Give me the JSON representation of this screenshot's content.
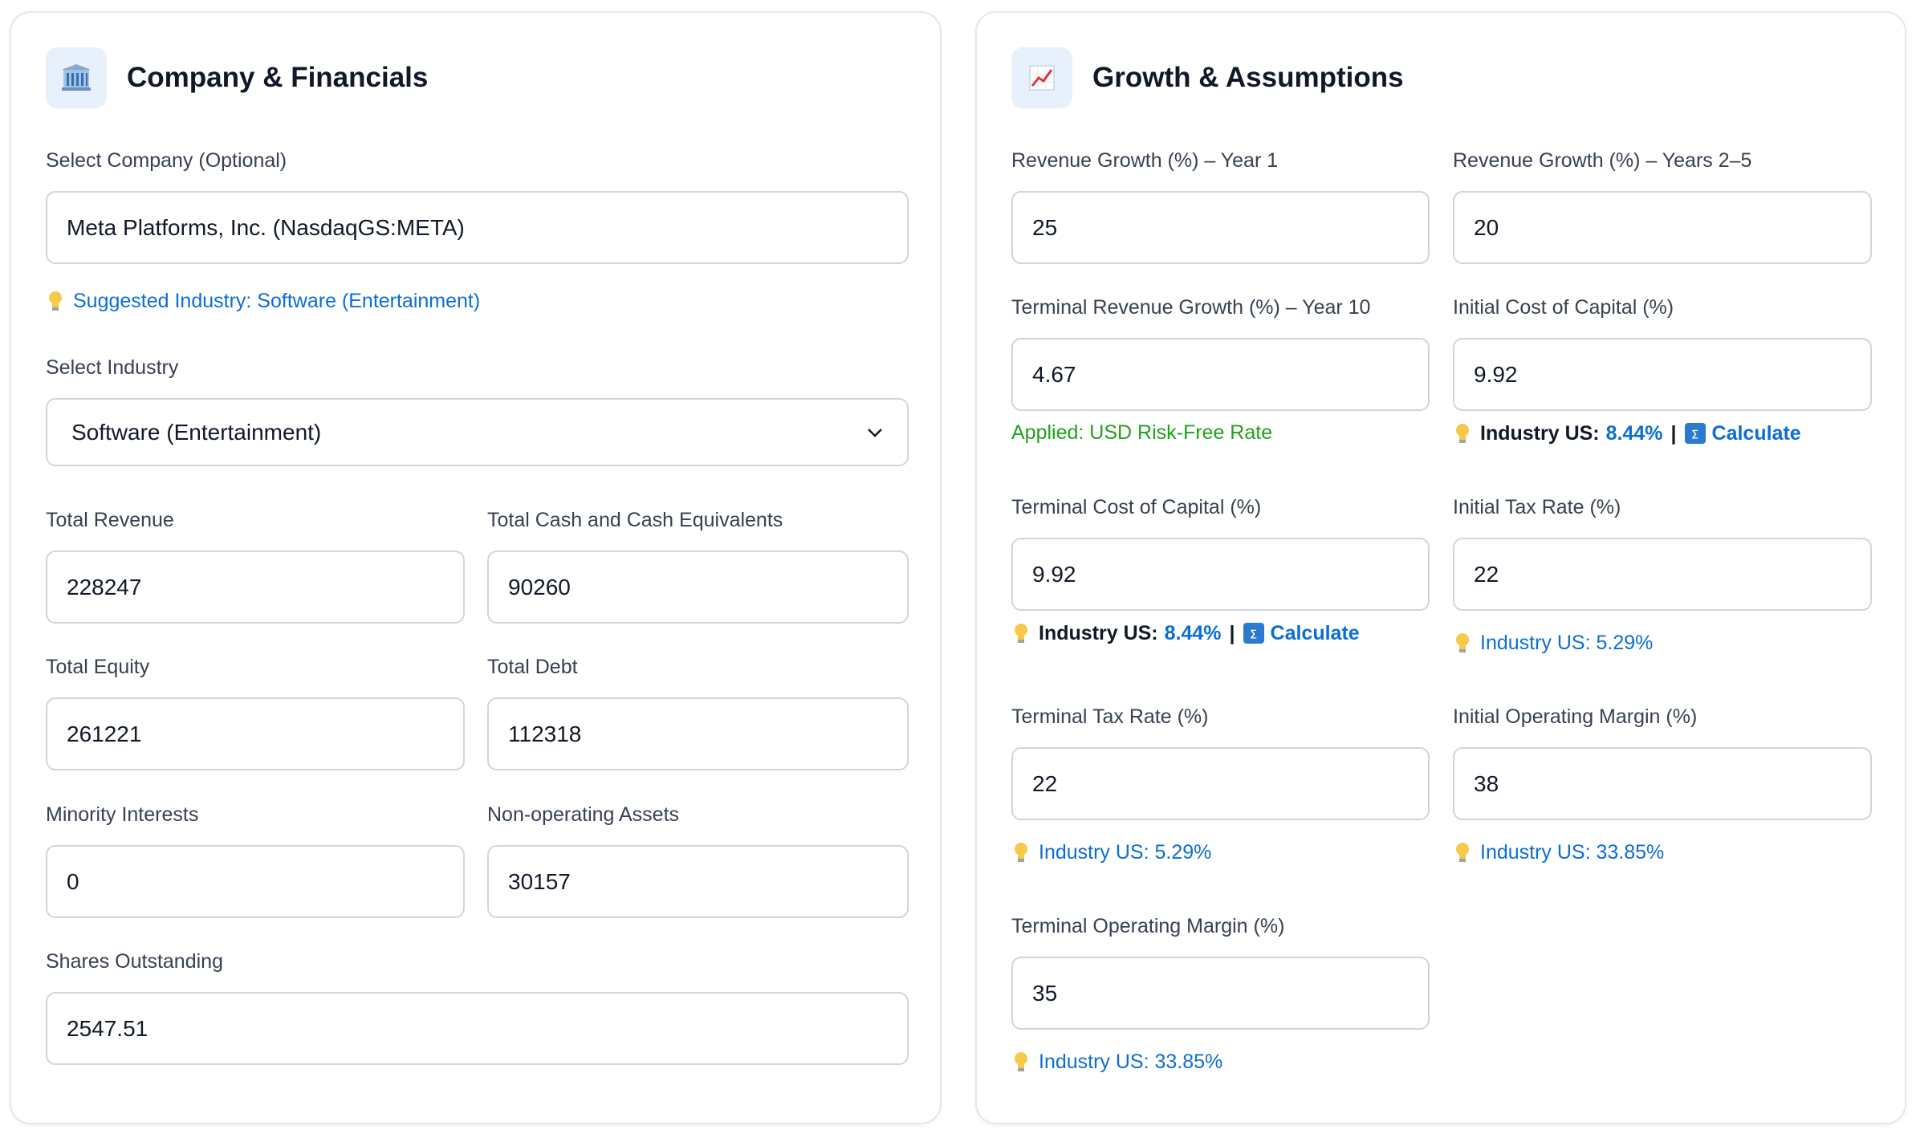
{
  "left_panel": {
    "title": "Company & Financials",
    "icon": "building-icon",
    "company": {
      "label": "Select Company (Optional)",
      "value": "Meta Platforms, Inc. (NasdaqGS:META)",
      "suggestion": "Suggested Industry: Software (Entertainment)"
    },
    "industry": {
      "label": "Select Industry",
      "selected": "Software (Entertainment)"
    },
    "total_revenue": {
      "label": "Total Revenue",
      "value": "228247"
    },
    "total_cash": {
      "label": "Total Cash and Cash Equivalents",
      "value": "90260"
    },
    "total_equity": {
      "label": "Total Equity",
      "value": "261221"
    },
    "total_debt": {
      "label": "Total Debt",
      "value": "112318"
    },
    "minority_interests": {
      "label": "Minority Interests",
      "value": "0"
    },
    "non_operating_assets": {
      "label": "Non-operating Assets",
      "value": "30157"
    },
    "shares_outstanding": {
      "label": "Shares Outstanding",
      "value": "2547.51"
    }
  },
  "right_panel": {
    "title": "Growth & Assumptions",
    "icon": "chart-increasing-icon",
    "revenue_growth_y1": {
      "label": "Revenue Growth (%) – Year 1",
      "value": "25"
    },
    "revenue_growth_y2_5": {
      "label": "Revenue Growth (%) – Years 2–5",
      "value": "20"
    },
    "terminal_revenue_growth": {
      "label": "Terminal Revenue Growth (%) – Year 10",
      "value": "4.67",
      "applied_note": "Applied: USD Risk-Free Rate"
    },
    "initial_cost_of_capital": {
      "label": "Initial Cost of Capital (%)",
      "value": "9.92",
      "industry_label": "Industry US:",
      "industry_value": "8.44%",
      "separator": "|",
      "calculate_label": "Calculate"
    },
    "terminal_cost_of_capital": {
      "label": "Terminal Cost of Capital (%)",
      "value": "9.92",
      "industry_label": "Industry US:",
      "industry_value": "8.44%",
      "separator": "|",
      "calculate_label": "Calculate"
    },
    "initial_tax_rate": {
      "label": "Initial Tax Rate (%)",
      "value": "22",
      "hint": "Industry US: 5.29%"
    },
    "terminal_tax_rate": {
      "label": "Terminal Tax Rate (%)",
      "value": "22",
      "hint": "Industry US: 5.29%"
    },
    "initial_operating_margin": {
      "label": "Initial Operating Margin (%)",
      "value": "38",
      "hint": "Industry US: 33.85%"
    },
    "terminal_operating_margin": {
      "label": "Terminal Operating Margin (%)",
      "value": "35",
      "hint": "Industry US: 33.85%"
    }
  },
  "colors": {
    "link": "#0b6ed6",
    "applied_green": "#22a11a",
    "border": "#d1d5db",
    "card_border": "#e5e7eb",
    "icon_bg": "#e8f1fb"
  }
}
